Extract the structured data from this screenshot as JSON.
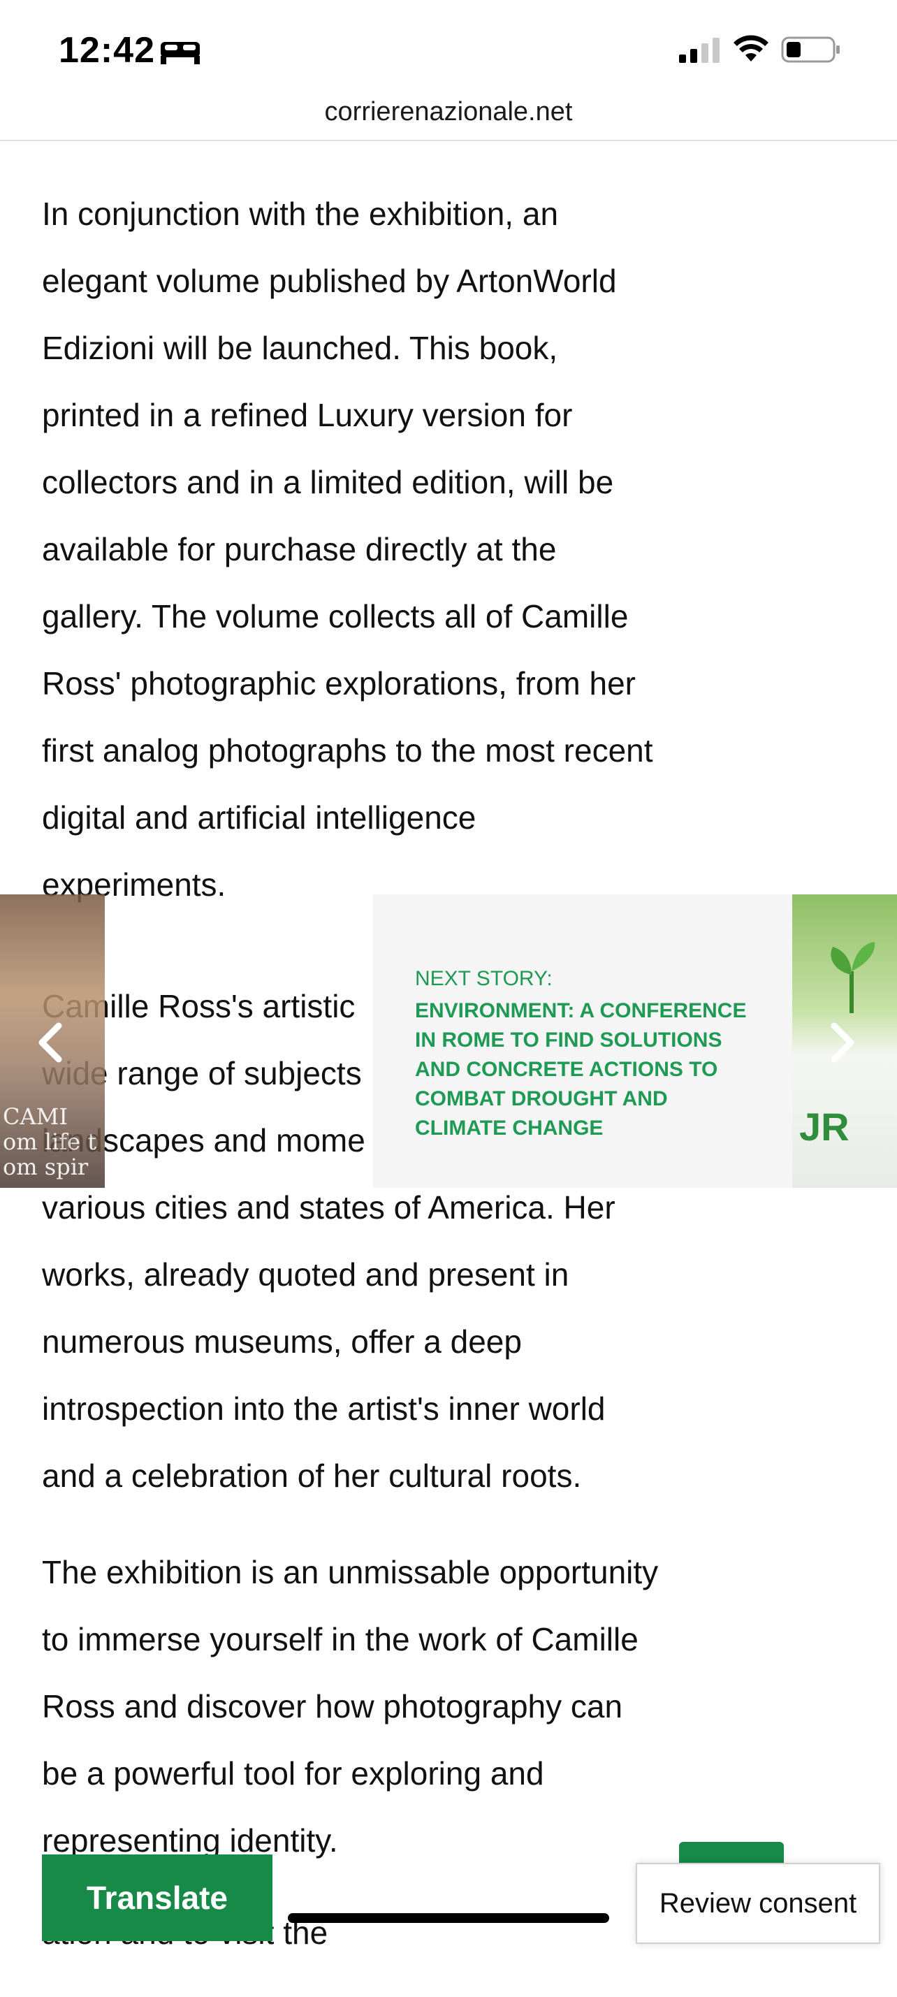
{
  "status_bar": {
    "time": "12:42",
    "icons": [
      "bed-icon",
      "cellular-signal-icon",
      "wifi-icon",
      "battery-icon"
    ]
  },
  "browser": {
    "url": "corrierenazionale.net"
  },
  "article": {
    "paragraph_1": "In conjunction with the exhibition, an\nelegant volume published by ArtonWorld\nEdizioni will be launched. This book,\nprinted in a refined Luxury version for\ncollectors and in a limited edition, will be\navailable for purchase directly at the\ngallery. The volume collects all of Camille\nRoss' photographic explorations, from her\nfirst analog photographs to the most recent\ndigital and artificial intelligence\nexperiments.",
    "paragraph_2": "Camille Ross's artistic\nwide range of subjects\nlandscapes and mome\nvarious cities and states of America. Her\nworks, already quoted and present in\nnumerous museums, offer a deep\nintrospection into the artist's inner world\nand a celebration of her cultural roots.",
    "paragraph_3": "The exhibition is an unmissable opportunity\nto immerse yourself in the work of Camille\nRoss and discover how photography can\nbe a powerful tool for exploring and\nrepresenting identity.",
    "paragraph_4": "ation and to visit the"
  },
  "carousel": {
    "left_thumb_text": "CAMI\nom life t\nom spir",
    "right_thumb_text": "JR",
    "next_label": "NEXT STORY:",
    "next_title": "ENVIRONMENT: A CONFERENCE IN ROME TO FIND SOLUTIONS AND CONCRETE ACTIONS TO COMBAT DROUGHT AND CLIMATE CHANGE"
  },
  "buttons": {
    "translate": "Translate",
    "review_consent": "Review consent"
  },
  "colors": {
    "accent_green": "#188a48",
    "next_story_green": "#1f9a55",
    "card_background": "#f5f5f5"
  }
}
